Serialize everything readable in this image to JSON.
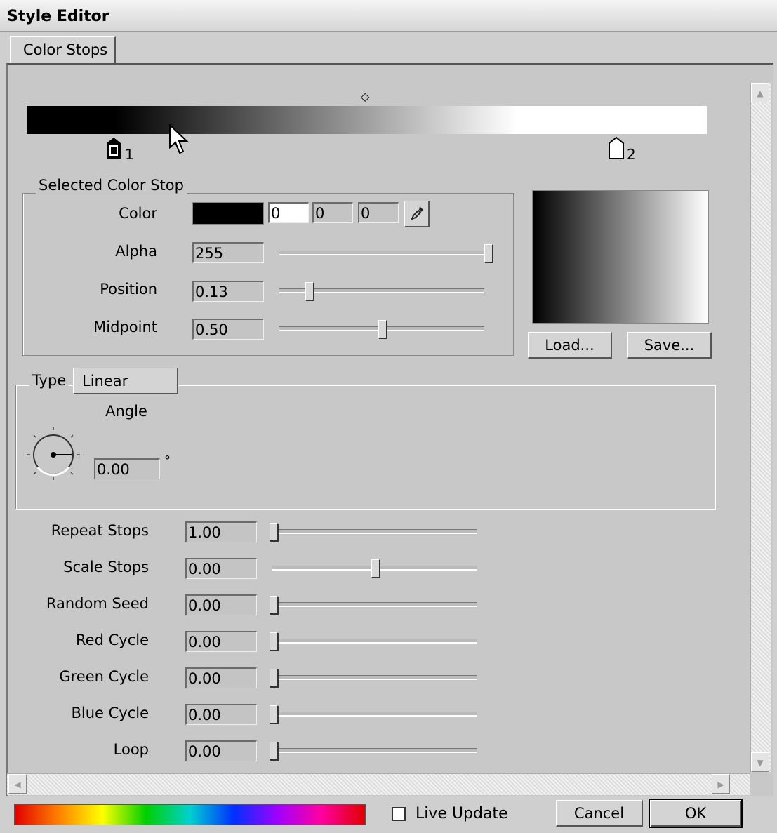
{
  "window": {
    "title": "Style Editor"
  },
  "tabs": [
    {
      "label": "Color Stops"
    }
  ],
  "gradient_bar": {
    "stops": [
      {
        "label": "1",
        "position": 0.13
      },
      {
        "label": "2",
        "position": 0.87
      }
    ],
    "midpoint": 0.5
  },
  "selected_stop": {
    "title": "Selected Color Stop",
    "color_label": "Color",
    "swatch": "#000000",
    "r": "0",
    "g": "0",
    "b": "0",
    "alpha_label": "Alpha",
    "alpha_value": "255",
    "alpha_level": 1.0,
    "position_label": "Position",
    "position_value": "0.13",
    "position_level": 0.13,
    "midpoint_label": "Midpoint",
    "midpoint_value": "0.50",
    "midpoint_level": 0.5
  },
  "preview": {
    "load_label": "Load...",
    "save_label": "Save..."
  },
  "type_group": {
    "type_label": "Type",
    "type_value": "Linear",
    "angle_label": "Angle",
    "angle_value": "0.00",
    "degree_symbol": "°"
  },
  "sliders": [
    {
      "label": "Repeat Stops",
      "value": "1.00",
      "level": 0.0
    },
    {
      "label": "Scale Stops",
      "value": "0.00",
      "level": 0.5
    },
    {
      "label": "Random Seed",
      "value": "0.00",
      "level": 0.0
    },
    {
      "label": "Red Cycle",
      "value": "0.00",
      "level": 0.0
    },
    {
      "label": "Green Cycle",
      "value": "0.00",
      "level": 0.0
    },
    {
      "label": "Blue Cycle",
      "value": "0.00",
      "level": 0.0
    },
    {
      "label": "Loop",
      "value": "0.00",
      "level": 0.0
    }
  ],
  "footer": {
    "live_update_label": "Live Update",
    "live_update_checked": false,
    "cancel_label": "Cancel",
    "ok_label": "OK"
  },
  "icons": {
    "eyedropper": "eyedropper-icon",
    "midpoint": "diamond-icon"
  }
}
